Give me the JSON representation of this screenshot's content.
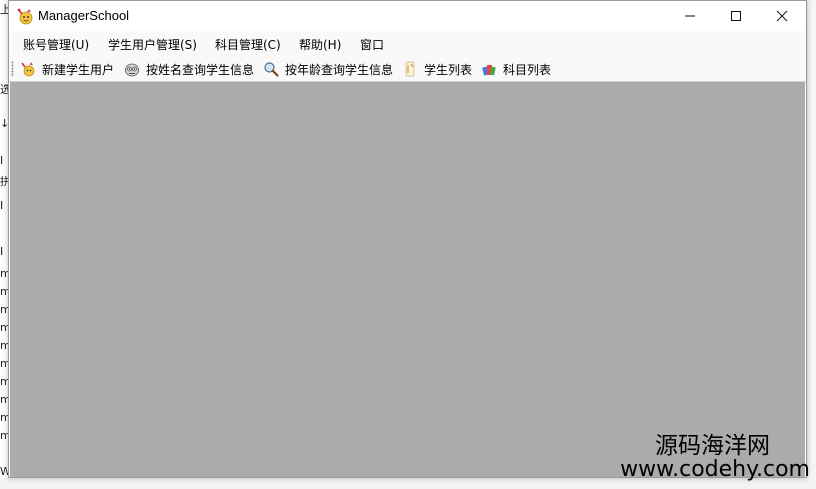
{
  "window": {
    "title": "ManagerSchool",
    "controls": {
      "minimize": "minimize",
      "maximize": "maximize",
      "close": "close"
    }
  },
  "menu": [
    {
      "label": "账号管理(U)"
    },
    {
      "label": "学生用户管理(S)"
    },
    {
      "label": "科目管理(C)"
    },
    {
      "label": "帮助(H)"
    },
    {
      "label": "窗口"
    }
  ],
  "toolbar": [
    {
      "label": "新建学生用户",
      "icon": "new-user-icon"
    },
    {
      "label": "按姓名查询学生信息",
      "icon": "search-by-name-icon"
    },
    {
      "label": "按年龄查询学生信息",
      "icon": "search-by-age-icon"
    },
    {
      "label": "学生列表",
      "icon": "student-list-icon"
    },
    {
      "label": "科目列表",
      "icon": "subject-list-icon"
    }
  ],
  "watermark": {
    "line1": "源码海洋网",
    "line2": "www.codehy.com"
  },
  "colors": {
    "mdi_background": "#ababab",
    "window_background": "#ffffff",
    "menubar_background": "#f9f9f9"
  }
}
